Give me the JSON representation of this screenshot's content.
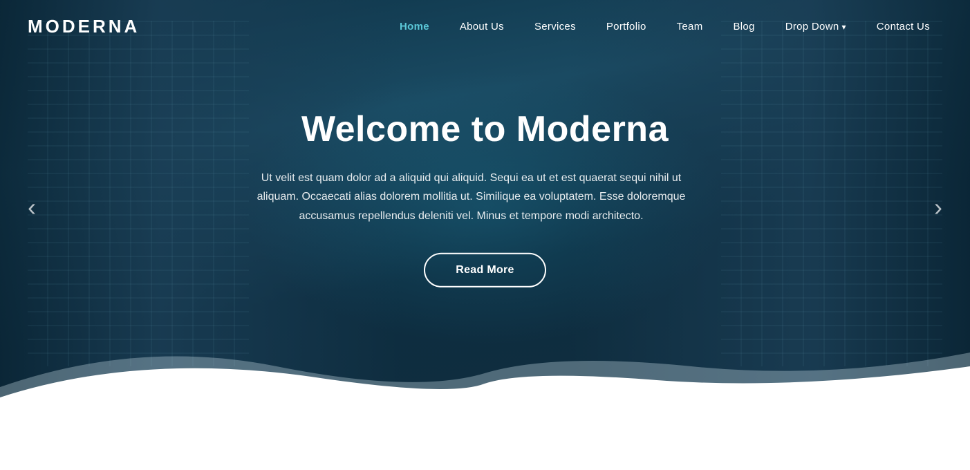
{
  "logo": {
    "text": "MODERNA"
  },
  "nav": {
    "items": [
      {
        "label": "Home",
        "active": true,
        "id": "home"
      },
      {
        "label": "About Us",
        "active": false,
        "id": "about"
      },
      {
        "label": "Services",
        "active": false,
        "id": "services"
      },
      {
        "label": "Portfolio",
        "active": false,
        "id": "portfolio"
      },
      {
        "label": "Team",
        "active": false,
        "id": "team"
      },
      {
        "label": "Blog",
        "active": false,
        "id": "blog"
      },
      {
        "label": "Drop Down",
        "active": false,
        "id": "dropdown",
        "hasChevron": true
      },
      {
        "label": "Contact Us",
        "active": false,
        "id": "contact"
      }
    ]
  },
  "hero": {
    "title": "Welcome to Moderna",
    "description": "Ut velit est quam dolor ad a aliquid qui aliquid. Sequi ea ut et est quaerat sequi nihil ut aliquam. Occaecati alias dolorem mollitia ut. Similique ea voluptatem. Esse doloremque accusamus repellendus deleniti vel. Minus et tempore modi architecto.",
    "cta_label": "Read More",
    "arrow_left": "‹",
    "arrow_right": "›"
  }
}
